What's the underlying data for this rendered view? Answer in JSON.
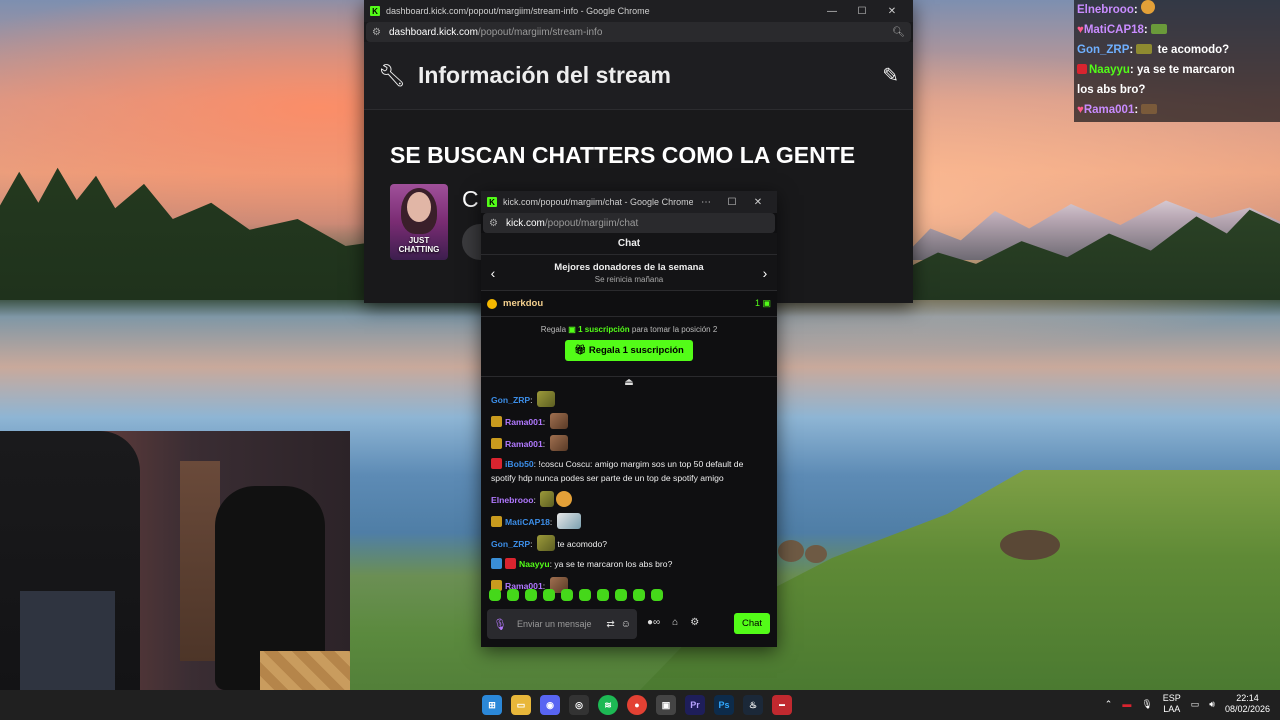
{
  "info_window": {
    "title": "dashboard.kick.com/popout/margiim/stream-info - Google Chrome",
    "url_host": "dashboard.kick.com",
    "url_path": "/popout/margiim/stream-info",
    "heading": "Información del stream",
    "stream_title": "SE BUSCAN CHATTERS COMO LA GENTE",
    "category_label": "JUST CHATTING",
    "partial_letter": "C"
  },
  "chat_window": {
    "title": "kick.com/popout/margiim/chat - Google Chrome",
    "url_host": "kick.com",
    "url_path": "/popout/margiim/chat",
    "header": "Chat",
    "donors_title": "Mejores donadores de la semana",
    "donors_subtitle": "Se reinicia mañana",
    "top_donor_name": "merkdou",
    "top_donor_count": "1",
    "gift_line_prefix": "Regala",
    "gift_line_bold": "1 suscripción",
    "gift_line_suffix": "para tomar la posición 2",
    "gift_button": "Regala 1 suscripción",
    "messages": [
      {
        "user": "Gon_ZRP",
        "color": "#3c8ee8",
        "text": ""
      },
      {
        "user": "Rama001",
        "color": "#b179ff",
        "text": ""
      },
      {
        "user": "Rama001",
        "color": "#b179ff",
        "text": ""
      },
      {
        "user": "iBob50",
        "color": "#3c8ee8",
        "text": "!coscu Coscu: amigo margim sos un top 50 default de spotify hdp nunca podes ser parte de un top de spotify amigo"
      },
      {
        "user": "Elnebrooo",
        "color": "#b179ff",
        "text": ""
      },
      {
        "user": "MatiCAP18",
        "color": "#3c8ee8",
        "text": ""
      },
      {
        "user": "Gon_ZRP",
        "color": "#3c8ee8",
        "text": "te acomodo?"
      },
      {
        "user": "Naayyu",
        "color": "#53fc18",
        "text": "ya se te marcaron los abs bro?"
      },
      {
        "user": "Rama001",
        "color": "#b179ff",
        "text": ""
      }
    ],
    "compose_placeholder": "Enviar un mensaje",
    "send_label": "Chat"
  },
  "overlay": [
    {
      "user": "Elnebrooo",
      "color": "#c98cff",
      "text": ""
    },
    {
      "user": "MatiCAP18",
      "color": "#c98cff",
      "text": ""
    },
    {
      "user": "Gon_ZRP",
      "color": "#6fb0ff",
      "text": "te acomodo?"
    },
    {
      "user": "Naayyu",
      "color": "#53fc18",
      "text": "ya se te marcaron"
    },
    {
      "user": "",
      "color": "#ffffff",
      "text": "los abs bro?"
    },
    {
      "user": "Rama001",
      "color": "#c98cff",
      "text": ""
    }
  ],
  "tray": {
    "lang_top": "ESP",
    "lang_bottom": "LAA",
    "time": "22:14",
    "date": "08/02/2026"
  }
}
